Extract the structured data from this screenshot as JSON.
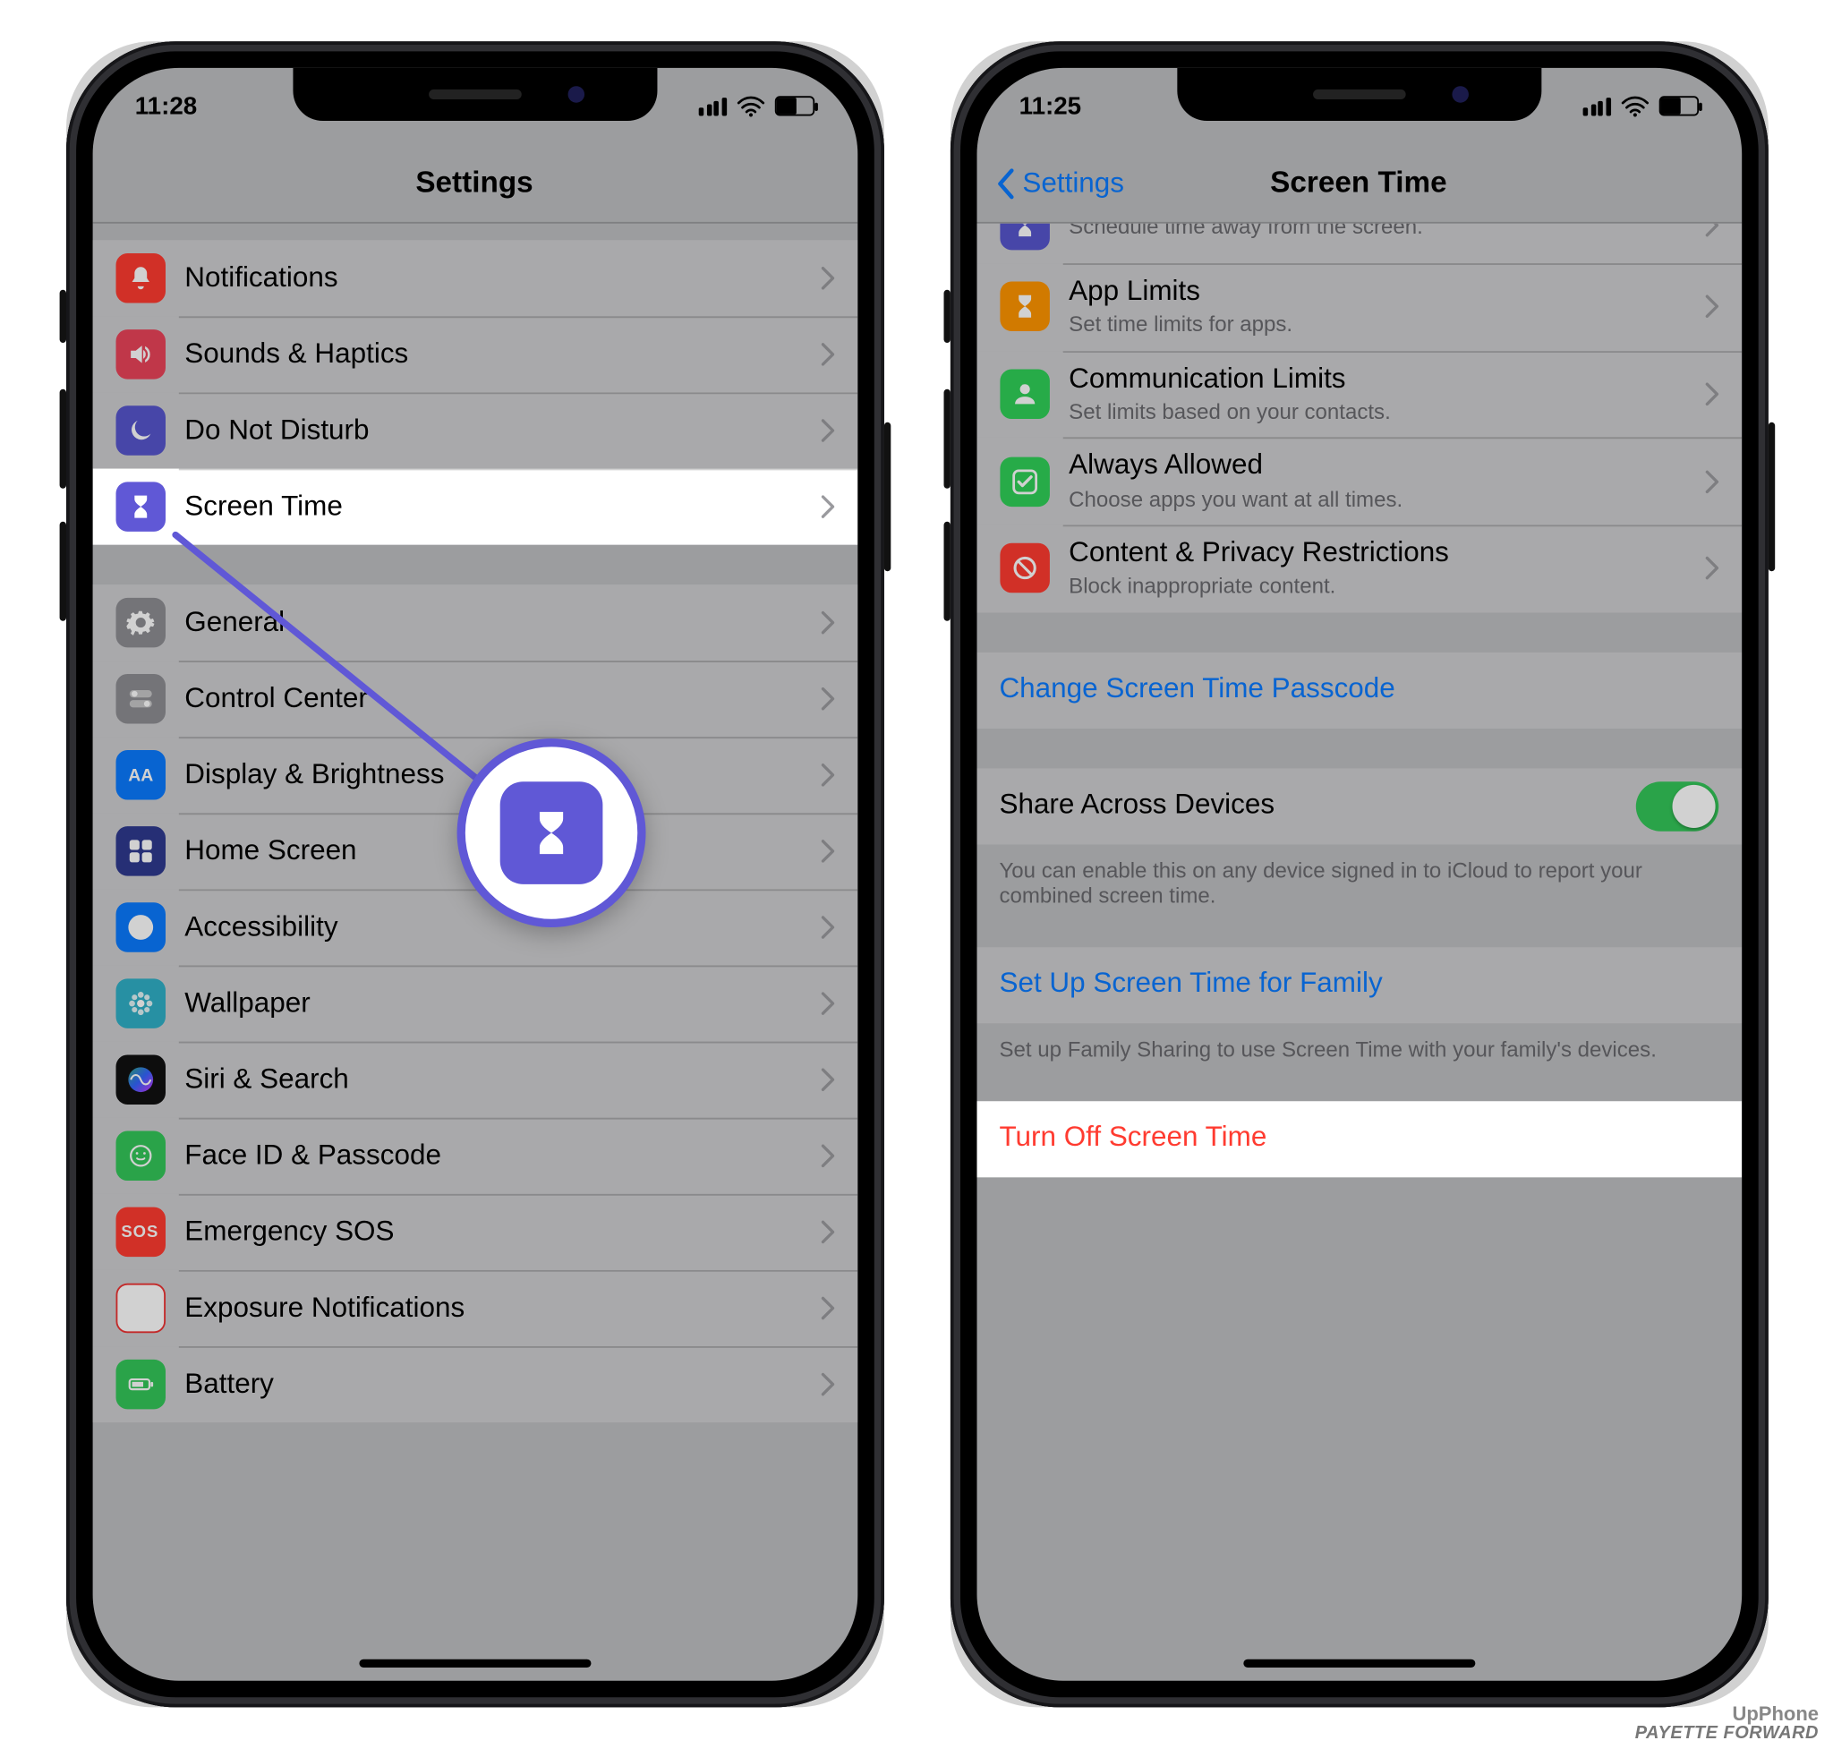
{
  "leftPhone": {
    "time": "11:28",
    "navTitle": "Settings",
    "rows": [
      {
        "icon": "notifications-icon",
        "bg": "bg-red",
        "title": "Notifications"
      },
      {
        "icon": "sounds-icon",
        "bg": "bg-red2",
        "title": "Sounds & Haptics"
      },
      {
        "icon": "moon-icon",
        "bg": "bg-indigo",
        "title": "Do Not Disturb"
      },
      {
        "icon": "hourglass-icon",
        "bg": "bg-purple",
        "title": "Screen Time",
        "highlight": true
      }
    ],
    "rows2": [
      {
        "icon": "gear-icon",
        "bg": "bg-gray",
        "title": "General"
      },
      {
        "icon": "switches-icon",
        "bg": "bg-gray2",
        "title": "Control Center"
      },
      {
        "icon": "aa-icon",
        "bg": "bg-blue",
        "title": "Display & Brightness"
      },
      {
        "icon": "grid-icon",
        "bg": "bg-tile",
        "title": "Home Screen"
      },
      {
        "icon": "accessibility-icon",
        "bg": "bg-blue",
        "title": "Accessibility"
      },
      {
        "icon": "flower-icon",
        "bg": "bg-cyan",
        "title": "Wallpaper"
      },
      {
        "icon": "siri-icon",
        "bg": "bg-black",
        "title": "Siri & Search"
      },
      {
        "icon": "faceid-icon",
        "bg": "bg-green",
        "title": "Face ID & Passcode"
      },
      {
        "icon": "sos-icon",
        "bg": "bg-sos",
        "title": "Emergency SOS"
      },
      {
        "icon": "covid-icon",
        "bg": "bg-covid",
        "title": "Exposure Notifications"
      },
      {
        "icon": "battery-icon",
        "bg": "bg-green",
        "title": "Battery"
      }
    ]
  },
  "rightPhone": {
    "time": "11:25",
    "backLabel": "Settings",
    "navTitle": "Screen Time",
    "topRows": [
      {
        "icon": "hourglass-icon",
        "bg": "bg-indigo",
        "title": "",
        "sub": "Schedule time away from the screen.",
        "truncated": true
      },
      {
        "icon": "hourglass-icon",
        "bg": "bg-orange",
        "title": "App Limits",
        "sub": "Set time limits for apps."
      },
      {
        "icon": "person-icon",
        "bg": "bg-green2",
        "title": "Communication Limits",
        "sub": "Set limits based on your contacts."
      },
      {
        "icon": "check-icon",
        "bg": "bg-green2",
        "title": "Always Allowed",
        "sub": "Choose apps you want at all times."
      },
      {
        "icon": "nosign-icon",
        "bg": "bg-red",
        "title": "Content & Privacy Restrictions",
        "sub": "Block inappropriate content."
      }
    ],
    "changePasscode": "Change Screen Time Passcode",
    "shareLabel": "Share Across Devices",
    "shareFooter": "You can enable this on any device signed in to iCloud to report your combined screen time.",
    "familyLabel": "Set Up Screen Time for Family",
    "familyFooter": "Set up Family Sharing to use Screen Time with your family's devices.",
    "turnOffLabel": "Turn Off Screen Time"
  },
  "watermark": {
    "line1": "UpPhone",
    "line2": "PAYETTE FORWARD"
  }
}
